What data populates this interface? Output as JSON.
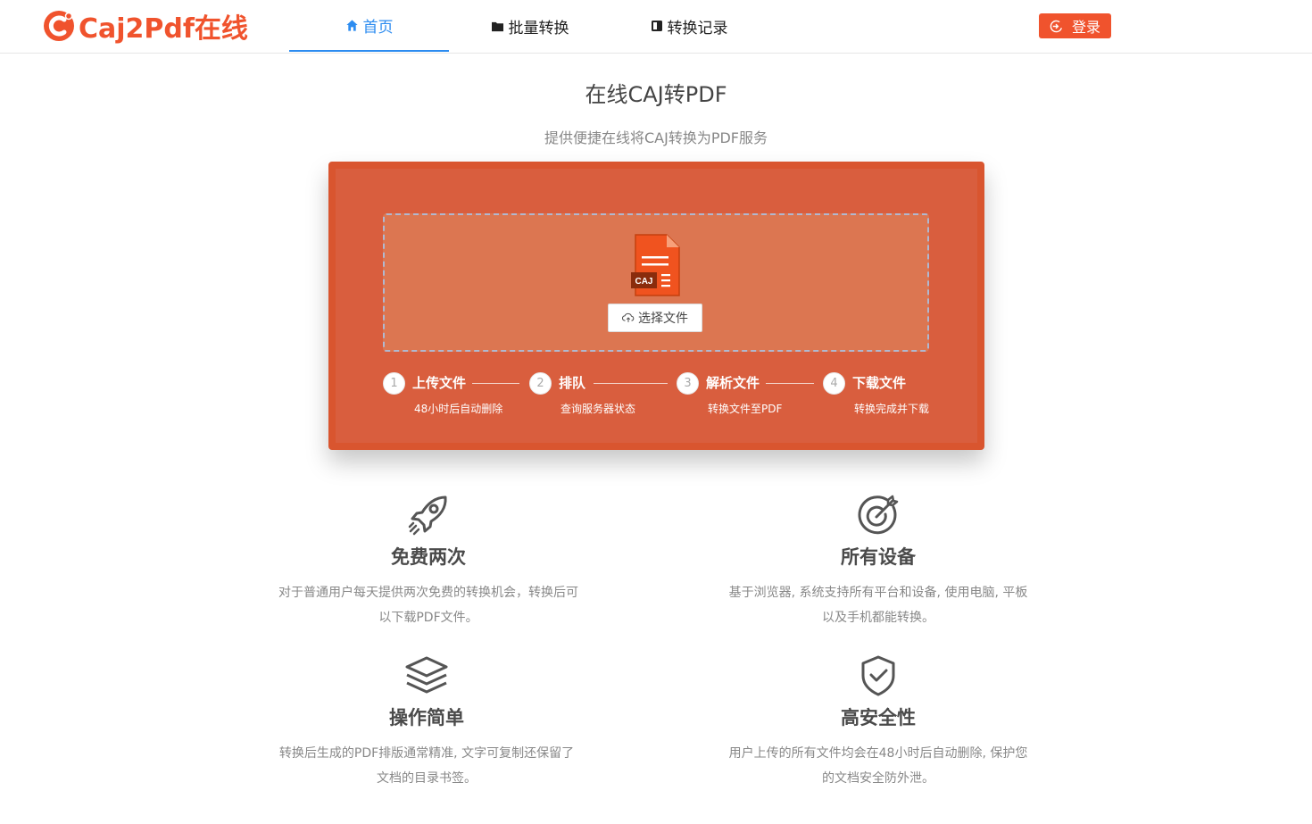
{
  "header": {
    "logo_text": "Caj2Pdf在线",
    "nav": [
      {
        "label": "首页",
        "icon": "home-icon"
      },
      {
        "label": "批量转换",
        "icon": "folder-icon"
      },
      {
        "label": "转换记录",
        "icon": "record-icon"
      }
    ],
    "login_label": "登录"
  },
  "hero": {
    "title": "在线CAJ转PDF",
    "subtitle": "提供便捷在线将CAJ转换为PDF服务"
  },
  "upload": {
    "file_badge": "CAJ",
    "choose_label": "选择文件"
  },
  "steps": [
    {
      "num": "1",
      "title": "上传文件",
      "desc": "48小时后自动删除"
    },
    {
      "num": "2",
      "title": "排队",
      "desc": "查询服务器状态"
    },
    {
      "num": "3",
      "title": "解析文件",
      "desc": "转换文件至PDF"
    },
    {
      "num": "4",
      "title": "下载文件",
      "desc": "转换完成并下载"
    }
  ],
  "features": [
    {
      "icon": "rocket-icon",
      "title": "免费两次",
      "desc_line1": "对于普通用户每天提供两次免费的转换机会，转换后可",
      "desc_line2": "以下载PDF文件。"
    },
    {
      "icon": "target-icon",
      "title": "所有设备",
      "desc_line1": "基于浏览器, 系统支持所有平台和设备, 使用电脑, 平板",
      "desc_line2": "以及手机都能转换。"
    },
    {
      "icon": "layers-icon",
      "title": "操作简单",
      "desc_line1": "转换后生成的PDF排版通常精准, 文字可复制还保留了",
      "desc_line2": "文档的目录书签。"
    },
    {
      "icon": "shield-check-icon",
      "title": "高安全性",
      "desc_line1": "用户上传的所有文件均会在48小时后自动删除, 保护您",
      "desc_line2": "的文档安全防外泄。"
    }
  ],
  "colors": {
    "brand": "#f0532d",
    "nav_active": "#2d8cf0",
    "panel": "#d95e3e"
  }
}
